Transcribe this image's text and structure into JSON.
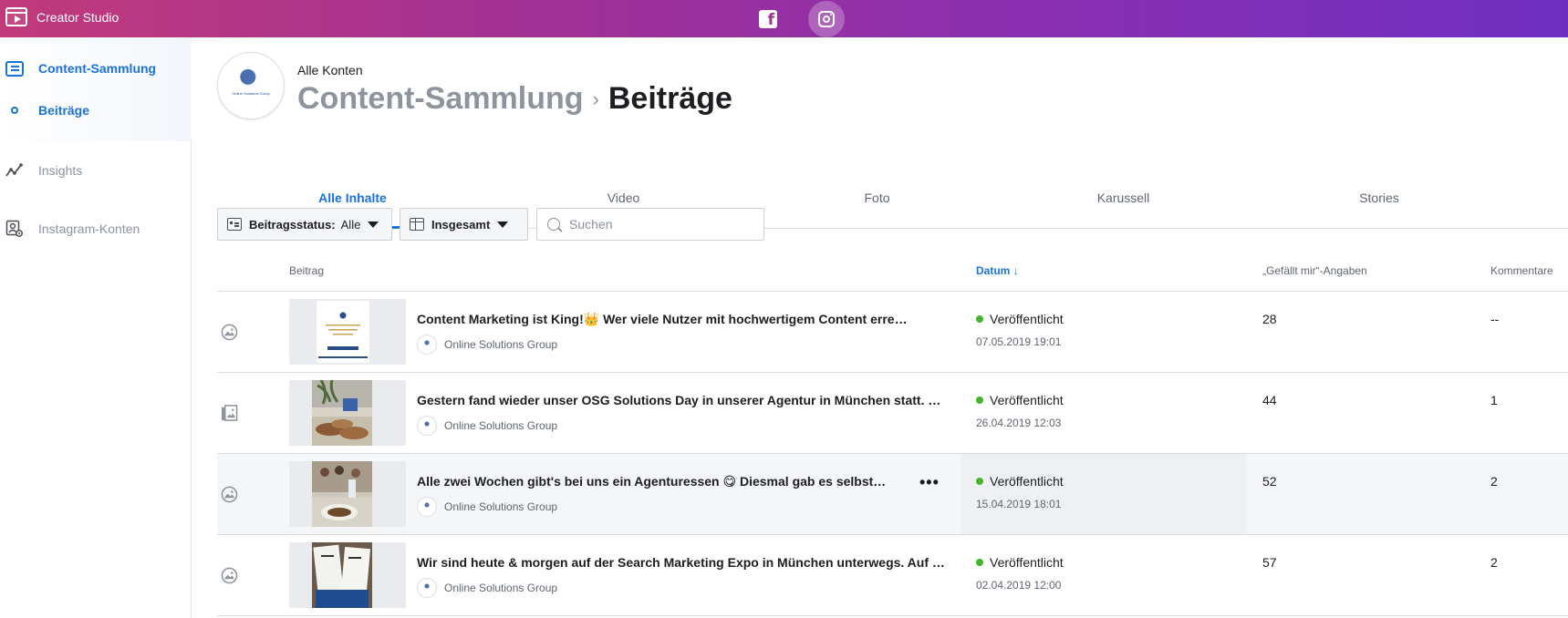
{
  "app": {
    "title": "Creator Studio"
  },
  "platforms": [
    {
      "name": "facebook-icon",
      "active": false
    },
    {
      "name": "instagram-icon",
      "active": true
    }
  ],
  "sidebar": {
    "items": [
      {
        "label": "Content-Sammlung",
        "icon": "collection-icon",
        "active": true
      },
      {
        "label": "Beiträge",
        "icon": "dot-icon",
        "active": true
      },
      {
        "label": "Insights",
        "icon": "insights-icon",
        "active": false
      },
      {
        "label": "Instagram-Konten",
        "icon": "account-settings-icon",
        "active": false
      }
    ]
  },
  "header": {
    "account_label": "Alle Konten",
    "avatar_text": "Online Solutions Group",
    "breadcrumb_parent": "Content-Sammlung",
    "breadcrumb_separator": "›",
    "breadcrumb_current": "Beiträge"
  },
  "tabs": [
    {
      "label": "Alle Inhalte",
      "active": true
    },
    {
      "label": "Video",
      "active": false
    },
    {
      "label": "Foto",
      "active": false
    },
    {
      "label": "Karussell",
      "active": false
    },
    {
      "label": "Stories",
      "active": false
    }
  ],
  "filters": {
    "status_label": "Beitragsstatus:",
    "status_value": "Alle",
    "total_label": "Insgesamt",
    "search_placeholder": "Suchen",
    "search_value": ""
  },
  "table": {
    "columns": {
      "post": "Beitrag",
      "date": "Datum ↓",
      "likes": "„Gefällt mir“-Angaben",
      "comments": "Kommentare"
    },
    "rows": [
      {
        "type_icon": "photo-icon",
        "title": "Content Marketing ist King!👑   Wer viele Nutzer mit hochwertigem Content erreichen möchte",
        "author": "Online Solutions Group",
        "status": "Veröffentlicht",
        "date": "07.05.2019 19:01",
        "likes": "28",
        "comments": "--",
        "highlighted": false
      },
      {
        "type_icon": "carousel-icon",
        "title": "Gestern fand wieder unser OSG Solutions Day in unserer Agentur in München statt. Viele",
        "author": "Online Solutions Group",
        "status": "Veröffentlicht",
        "date": "26.04.2019 12:03",
        "likes": "44",
        "comments": "1",
        "highlighted": false
      },
      {
        "type_icon": "photo-icon",
        "title": "Alle zwei Wochen gibt's bei uns ein Agenturessen 😋 Diesmal gab es selbstgemachte",
        "author": "Online Solutions Group",
        "status": "Veröffentlicht",
        "date": "15.04.2019 18:01",
        "likes": "52",
        "comments": "2",
        "highlighted": true,
        "more": "•••"
      },
      {
        "type_icon": "photo-icon",
        "title": "Wir sind heute & morgen auf der Search Marketing Expo in München unterwegs. Auf der",
        "author": "Online Solutions Group",
        "status": "Veröffentlicht",
        "date": "02.04.2019 12:00",
        "likes": "57",
        "comments": "2",
        "highlighted": false
      }
    ]
  },
  "colors": {
    "accent": "#1a73d9",
    "status_published": "#42b72a",
    "topbar_start": "#c03a7a",
    "topbar_end": "#6e2fc0"
  }
}
